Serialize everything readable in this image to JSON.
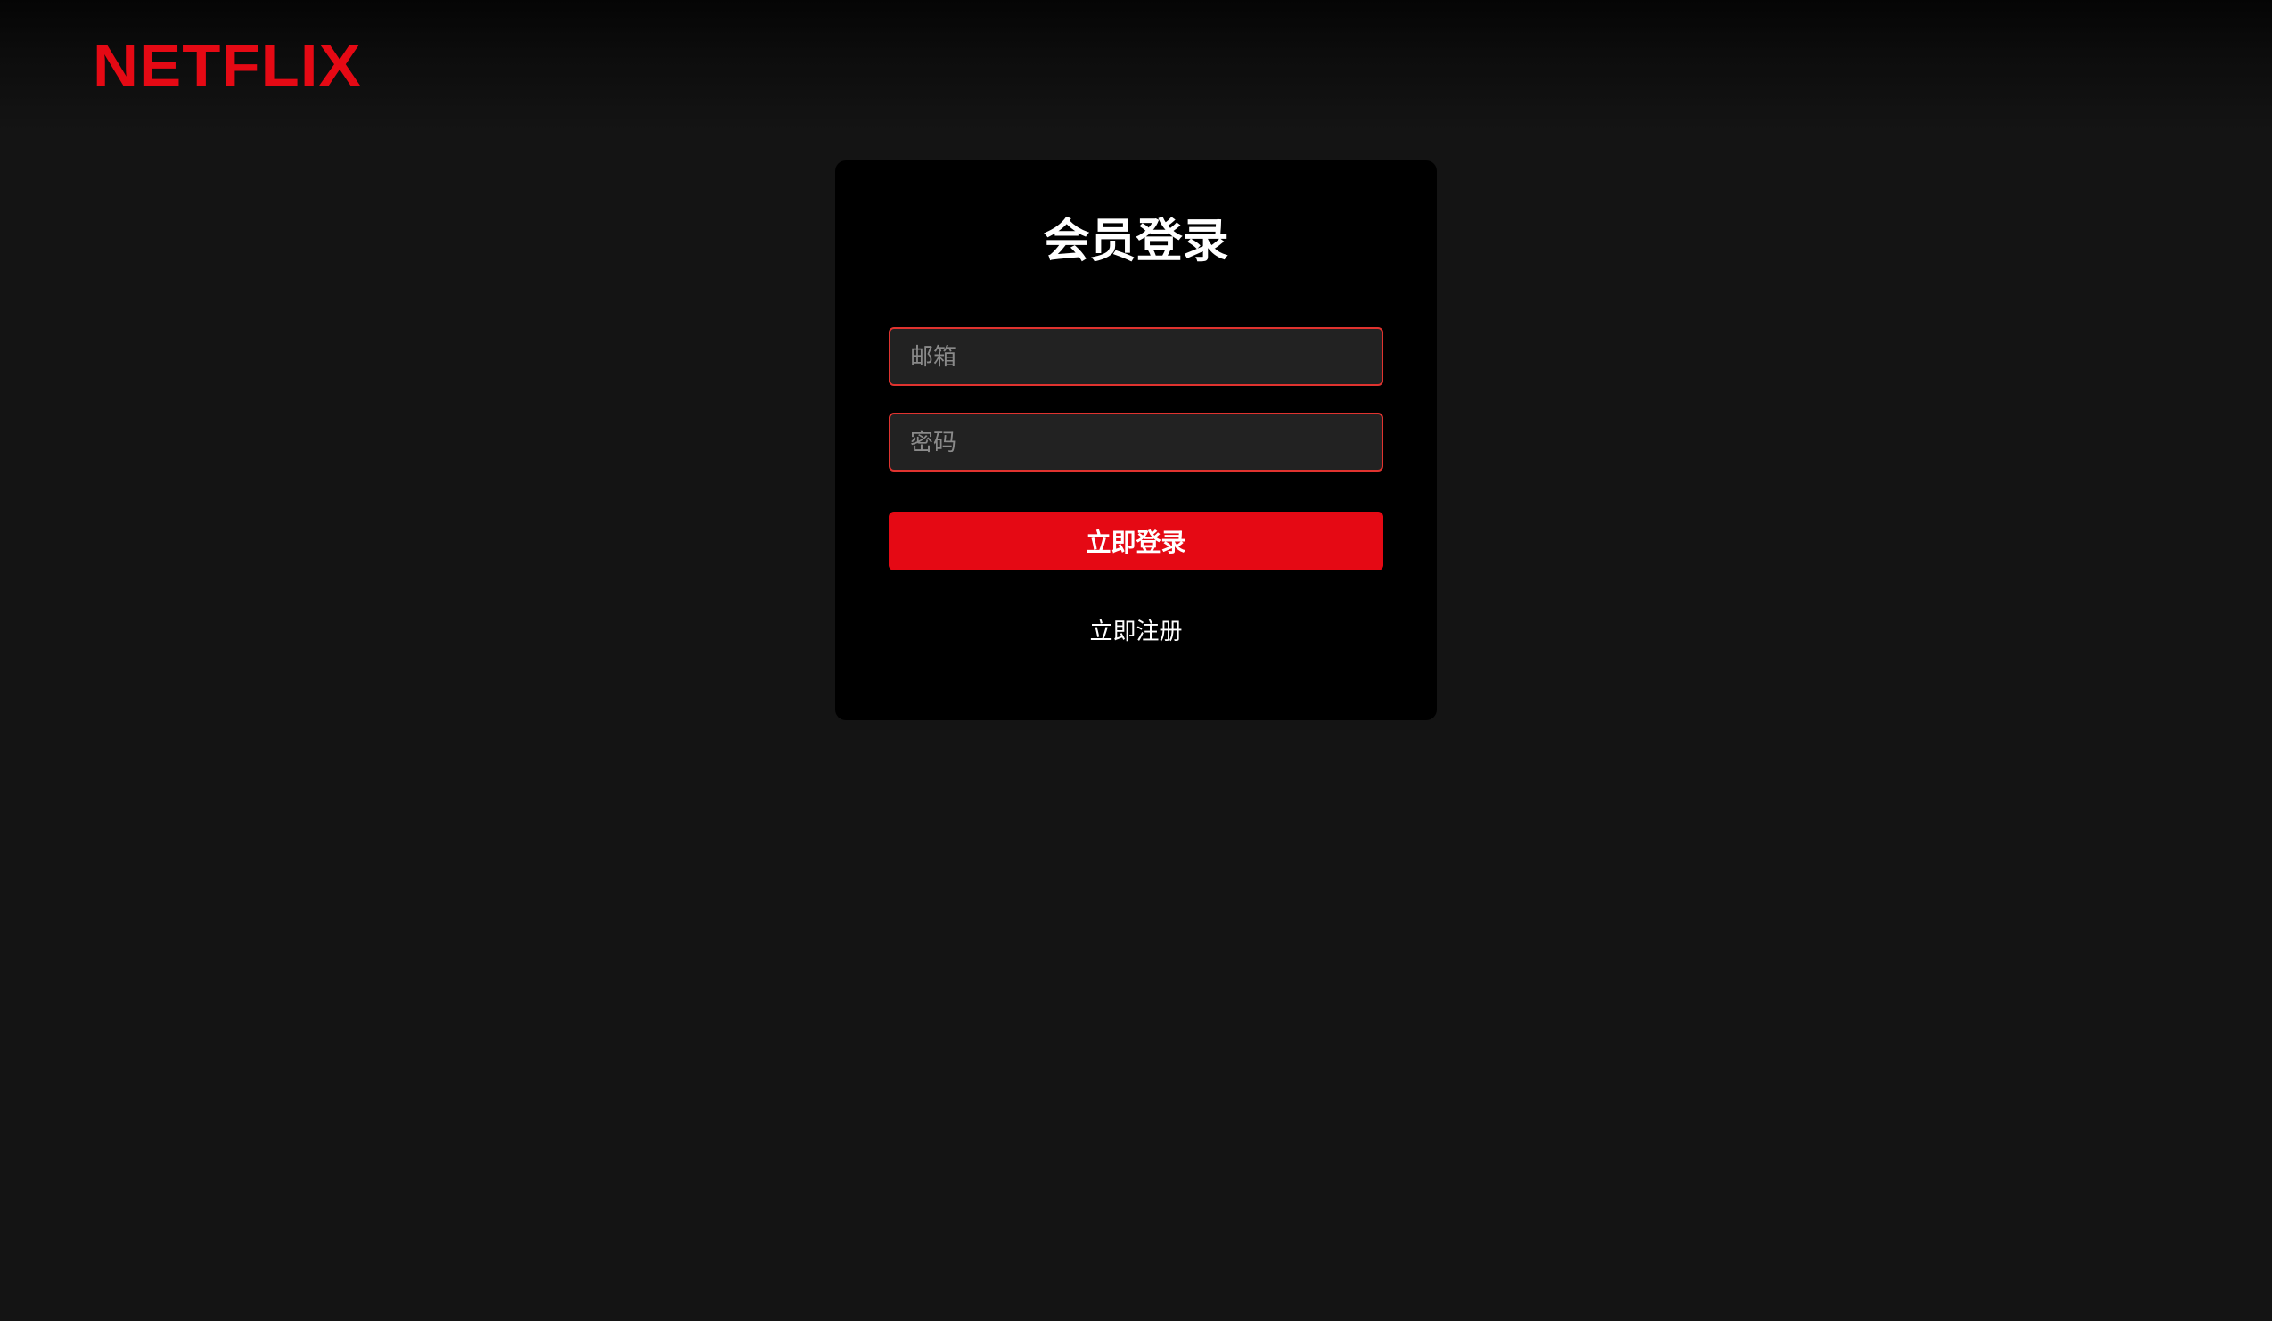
{
  "brand": {
    "logo_text": "NETFLIX",
    "color": "#e50914"
  },
  "login_card": {
    "title": "会员登录",
    "email_placeholder": "邮箱",
    "password_placeholder": "密码",
    "submit_label": "立即登录",
    "register_label": "立即注册"
  },
  "colors": {
    "background": "#141414",
    "card": "#000000",
    "input_background": "#222222",
    "input_border": "#e0332f",
    "button": "#e50914"
  }
}
